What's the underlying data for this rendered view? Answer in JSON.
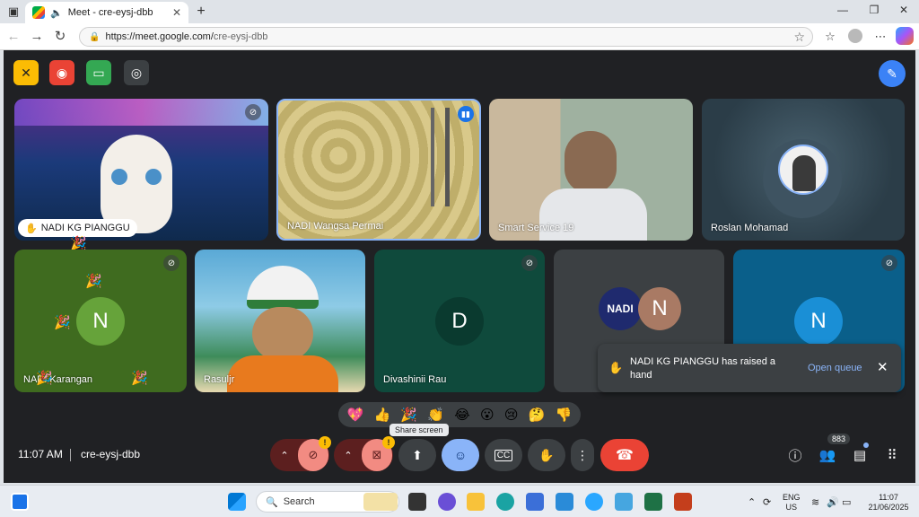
{
  "browser": {
    "tab_title": "Meet - cre-eysj-dbb",
    "url_domain": "https://meet.google.com/",
    "url_path": "cre-eysj-dbb"
  },
  "tiles": [
    {
      "name": "NADI KG PIANGGU",
      "muted": true
    },
    {
      "name": "NADI Wangsa Permai",
      "speaking": true
    },
    {
      "name": "Smart Service 19"
    },
    {
      "name": "Roslan Mohamad"
    },
    {
      "name": "NADI Karangan",
      "initial": "N",
      "muted": true
    },
    {
      "name": "Rasuljr"
    },
    {
      "name": "Divashinii Rau",
      "initial": "D",
      "muted": true
    },
    {
      "name": "",
      "initial": "N",
      "logo": "NADI"
    },
    {
      "name": "",
      "initial": "N",
      "muted": true
    }
  ],
  "reactions": [
    "💖",
    "👍",
    "🎉",
    "👏",
    "😂",
    "😮",
    "😢",
    "🤔",
    "👎"
  ],
  "tooltip": "Share screen",
  "bottom": {
    "time": "11:07 AM",
    "meeting_code": "cre-eysj-dbb",
    "participants_count": "883"
  },
  "notification": {
    "message": "NADI KG PIANGGU has raised a hand",
    "action": "Open queue"
  },
  "taskbar": {
    "search_placeholder": "Search",
    "lang_top": "ENG",
    "lang_bottom": "US",
    "time": "11:07",
    "date": "21/06/2025"
  },
  "colors": {
    "meet_bg": "#202124",
    "hangup": "#ea4335",
    "accent_blue": "#8ab4f8",
    "muted_red": "#5c1f1f"
  }
}
